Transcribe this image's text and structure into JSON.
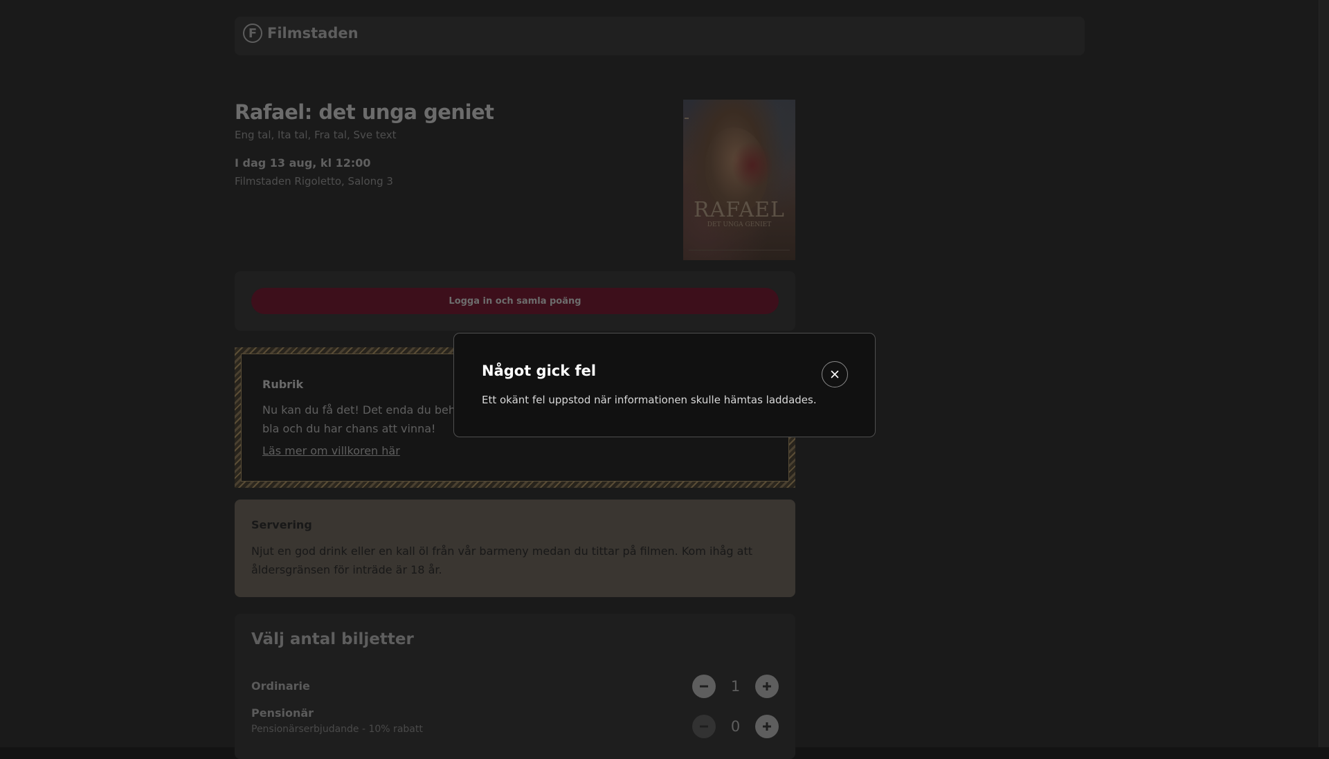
{
  "header": {
    "logo_letter": "F",
    "brand": "Filmstaden"
  },
  "movie": {
    "title": "Rafael: det unga geniet",
    "languages": "Eng tal, Ita tal, Fra tal, Sve text",
    "showtime": "I dag 13 aug, kl 12:00",
    "venue": "Filmstaden Rigoletto, Salong 3",
    "poster": {
      "title": "RAFAEL",
      "subtitle": "DET UNGA GENIET"
    }
  },
  "login": {
    "button_label": "Logga in och samla poäng"
  },
  "promo": {
    "heading": "Rubrik",
    "text": "Nu kan du få det! Det enda du beh… bla och du har chans att vinna!",
    "text_line1": "Nu kan du få det! Det enda du beh",
    "text_line2": "bla och du har chans att vinna!",
    "link": "Läs mer om villkoren här"
  },
  "serving": {
    "heading": "Servering",
    "text": "Njut en god drink eller en kall öl från vår barmeny medan du tittar på filmen. Kom ihåg att åldersgränsen för inträde är 18 år."
  },
  "tickets": {
    "heading": "Välj antal biljetter",
    "rows": [
      {
        "name": "Ordinarie",
        "description": "",
        "quantity": "1"
      },
      {
        "name": "Pensionär",
        "description": "Pensionärserbjudande - 10% rabatt",
        "quantity": "0"
      }
    ]
  },
  "modal": {
    "title": "Något gick fel",
    "message": "Ett okänt fel uppstod när informationen skulle hämtas laddades."
  },
  "colors": {
    "overlay_bg": "#1a1a1a",
    "login_button": "#3d0f1b",
    "serving_card": "#3a3631",
    "modal_bg": "#111111"
  }
}
